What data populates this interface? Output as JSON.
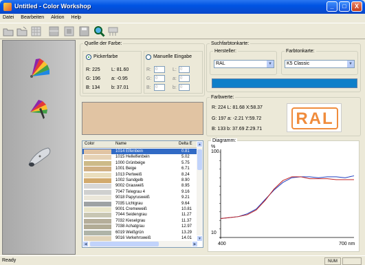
{
  "window": {
    "title": "Untitled - Color Workshop",
    "min": "_",
    "max": "□",
    "close": "X"
  },
  "menu": [
    "Datei",
    "Bearbeiten",
    "Aktion",
    "Help"
  ],
  "toolbar": [
    "open-icon",
    "save-icon",
    "grid-icon",
    "split-icon",
    "frame-icon",
    "floppy-icon",
    "search-icon",
    "measure-icon"
  ],
  "sidebar": [
    "color-fan-icon",
    "picker-fan-icon",
    "spectrometer-icon"
  ],
  "source": {
    "legend": "Quelle der Farbe:",
    "picker_label": "Pickerfarbe",
    "manual_label": "Manuelle Eingabe",
    "R": "R: 225",
    "G": "G: 196",
    "B": "B: 134",
    "L": "L: 81.60",
    "a": "a: -0.95",
    "b": "b: 37.01",
    "mR": "R:",
    "mG": "G:",
    "mB": "B:",
    "mL": "L:",
    "ma": "a:",
    "mb": "b:",
    "mv": "0"
  },
  "search": {
    "legend": "Suchfarbtonkarte:",
    "hersteller_label": "Hersteller:",
    "hersteller_value": "RAL",
    "karte_label": "Farbtonkarte:",
    "karte_value": "K5 Classic",
    "bar_color": "#0e7fc9"
  },
  "values": {
    "legend": "Farbwerte:",
    "r1": "R: 224  L: 81.68  X:58.37",
    "r2": "G: 197  a: -2.21  Y:59.72",
    "r3": "B: 133  b: 37.69  Z:29.71",
    "logo": "RAL"
  },
  "swatch_color": "#e1c4a3",
  "table": {
    "headers": [
      "Color",
      "Name",
      "Delta E"
    ],
    "rows": [
      {
        "color": "#e1c4a3",
        "name": "1014 Elfenbein",
        "delta": "0.81",
        "sel": true
      },
      {
        "color": "#e6d2b5",
        "name": "1015 Hellelfenbein",
        "delta": "5.02"
      },
      {
        "color": "#cdba88",
        "name": "1000 Grünbeige",
        "delta": "5.75"
      },
      {
        "color": "#d0b084",
        "name": "1001 Beige",
        "delta": "6.71"
      },
      {
        "color": "#eadebd",
        "name": "1013 Perlweiß",
        "delta": "8.24"
      },
      {
        "color": "#d2aa6d",
        "name": "1002 Sandgelb",
        "delta": "8.90"
      },
      {
        "color": "#d7d7d7",
        "name": "9002 Grauweiß",
        "delta": "8.95"
      },
      {
        "color": "#cfd0cf",
        "name": "7047 Telegrau 4",
        "delta": "9.16"
      },
      {
        "color": "#ebe7da",
        "name": "9018 Papyrusweiß",
        "delta": "9.21"
      },
      {
        "color": "#9ea2a4",
        "name": "7035 Lichtgrau",
        "delta": "9.64"
      },
      {
        "color": "#eae6ca",
        "name": "9001 Cremeweiß",
        "delta": "10.81"
      },
      {
        "color": "#c8c6b3",
        "name": "7044 Seidengrau",
        "delta": "11.27"
      },
      {
        "color": "#b5ae9a",
        "name": "7032 Kieselgrau",
        "delta": "11.37"
      },
      {
        "color": "#b2ac96",
        "name": "7038 Achatgrau",
        "delta": "12.97"
      },
      {
        "color": "#afb4a8",
        "name": "6019 Weißgrün",
        "delta": "13.29"
      },
      {
        "color": "#e1d4b9",
        "name": "9016 Verkehrsweiß",
        "delta": "14.01"
      }
    ]
  },
  "diagram": {
    "legend": "Diagramm:",
    "unit": "%",
    "y_top": "100",
    "y_bottom": "10",
    "x_left": "400",
    "x_right": "700 nm"
  },
  "chart_data": {
    "type": "line",
    "title": "",
    "xlabel": "nm",
    "ylabel": "%",
    "xlim": [
      400,
      700
    ],
    "ylim": [
      10,
      100
    ],
    "x": [
      400,
      420,
      440,
      460,
      480,
      500,
      520,
      540,
      560,
      580,
      600,
      620,
      640,
      660,
      680,
      700
    ],
    "series": [
      {
        "color": "#2040c0",
        "values": [
          30,
          31,
          32,
          35,
          40,
          50,
          60,
          68,
          73,
          74,
          74,
          73,
          74,
          74,
          73,
          75
        ]
      },
      {
        "color": "#c02020",
        "values": [
          30,
          31,
          32,
          34,
          39,
          49,
          61,
          70,
          74,
          74,
          72,
          72,
          72,
          71,
          71,
          71
        ]
      }
    ]
  },
  "status": {
    "text": "Ready",
    "num": "NUM"
  }
}
